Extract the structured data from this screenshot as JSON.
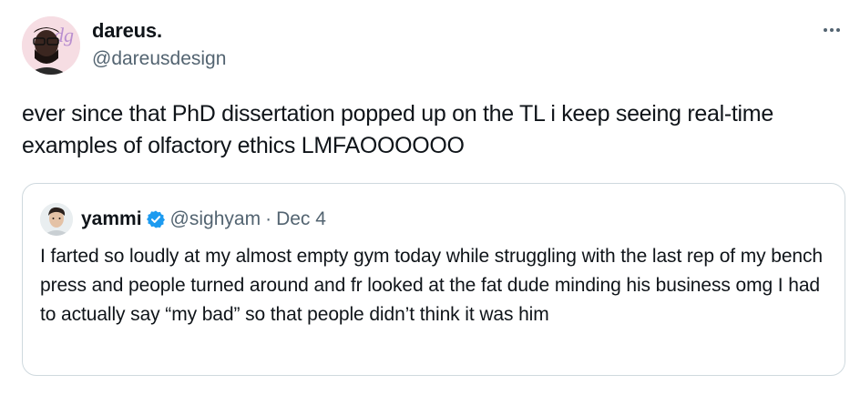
{
  "tweet": {
    "author_name": "dareus.",
    "author_handle": "@dareusdesign",
    "text": "ever since that PhD dissertation popped up on the TL i keep seeing real-time examples of olfactory ethics LMFAOOOOOO",
    "more_icon": "more-horizontal-icon"
  },
  "quote": {
    "author_name": "yammi",
    "author_handle": "@sighyam",
    "separator": "·",
    "date": "Dec 4",
    "verified_icon": "verified-badge-icon",
    "text": "I farted so loudly at my almost empty gym today while struggling with the last rep of my bench press and people turned around and fr looked at the fat dude minding his business omg I had to actually say “my bad” so that people didn’t think it was him"
  },
  "colors": {
    "text": "#0f1419",
    "secondary": "#536471",
    "border": "#cfd9de",
    "verified": "#1d9bf0"
  }
}
